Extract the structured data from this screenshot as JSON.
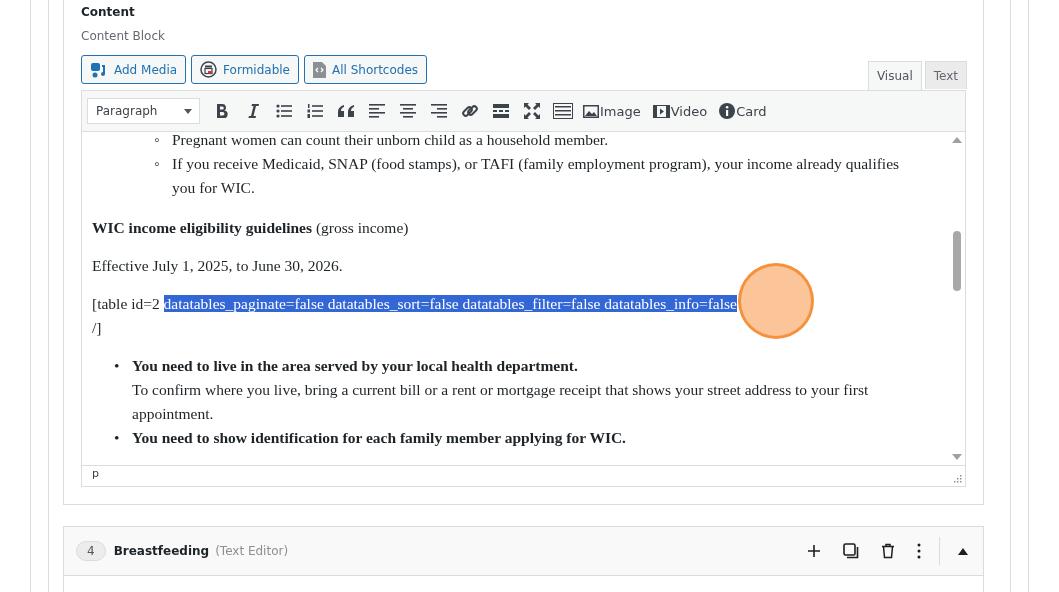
{
  "field": {
    "label": "Content",
    "description": "Content Block"
  },
  "media_buttons": [
    "Add Media",
    "Formidable",
    "All Shortcodes"
  ],
  "tabs": [
    {
      "label": "Visual",
      "selected": true
    },
    {
      "label": "Text",
      "selected": false
    }
  ],
  "toolbar": {
    "format": "Paragraph",
    "labeled_buttons": [
      "Image",
      "Video",
      "Card"
    ]
  },
  "content": [
    {
      "kind": "circle-list",
      "marker": "◦",
      "items": [
        "Pregnant women can count their unborn child as a household member.",
        "If you receive Medicaid, SNAP (food stamps), or TAFI (family employment program), your income already qualifies you for WIC."
      ]
    },
    {
      "kind": "paragraph",
      "text": "**WIC income eligibility guidelines** (gross income)"
    },
    {
      "kind": "paragraph",
      "text": "Effective July 1, 2025, to June 30, 2026."
    },
    {
      "kind": "shortcode",
      "before": "[table id=2 ",
      "selected_text": "datatables_paginate=false datatables_sort=false datatables_filter=false datatables_info=false",
      "after": "/]"
    },
    {
      "kind": "disc-list",
      "marker": "•",
      "items": [
        {
          "heading": "You need to live in the area served by your local health department.",
          "text": "To confirm where you live, bring a current bill or a rent or mortgage receipt that shows your street address to your first appointment."
        },
        {
          "heading": "You need to show identification for each family member applying for WIC."
        }
      ]
    }
  ],
  "status_path": "p",
  "next_block": {
    "number": "4",
    "title": "Breastfeeding",
    "type": "(Text Editor)"
  }
}
